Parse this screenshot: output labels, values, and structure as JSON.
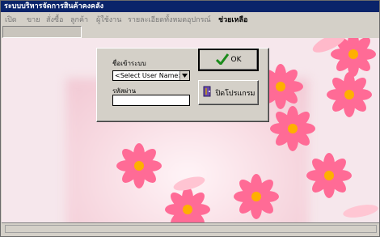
{
  "window": {
    "title": "ระบบบริหารจัดการสินค้าคงคลัง"
  },
  "menu": {
    "items": [
      {
        "label": "เปิด"
      },
      {
        "label": "ขาย"
      },
      {
        "label": "สั่งซื้อ"
      },
      {
        "label": "ลูกค้า"
      },
      {
        "label": "ผู้ใช้งาน"
      },
      {
        "label": "รายละเอียดทั้งหมด"
      },
      {
        "label": "อุปกรณ์"
      },
      {
        "label": "ช่วยเหลือ"
      }
    ]
  },
  "login": {
    "username_label": "ชื่อเข้าระบบ",
    "username_selected": "<Select User Name>",
    "password_label": "รหัสผ่าน",
    "password_value": "",
    "ok_label": "OK",
    "close_label": "ปิดโปรแกรม"
  },
  "colors": {
    "titlebar": "#0a246a",
    "face": "#d4d0c8",
    "petal": "#ff5f8c",
    "center": "#ffb000",
    "check": "#1b8b1b"
  },
  "icons": {
    "ok": "check-icon",
    "close": "door-exit-icon",
    "dropdown": "chevron-down-icon"
  }
}
